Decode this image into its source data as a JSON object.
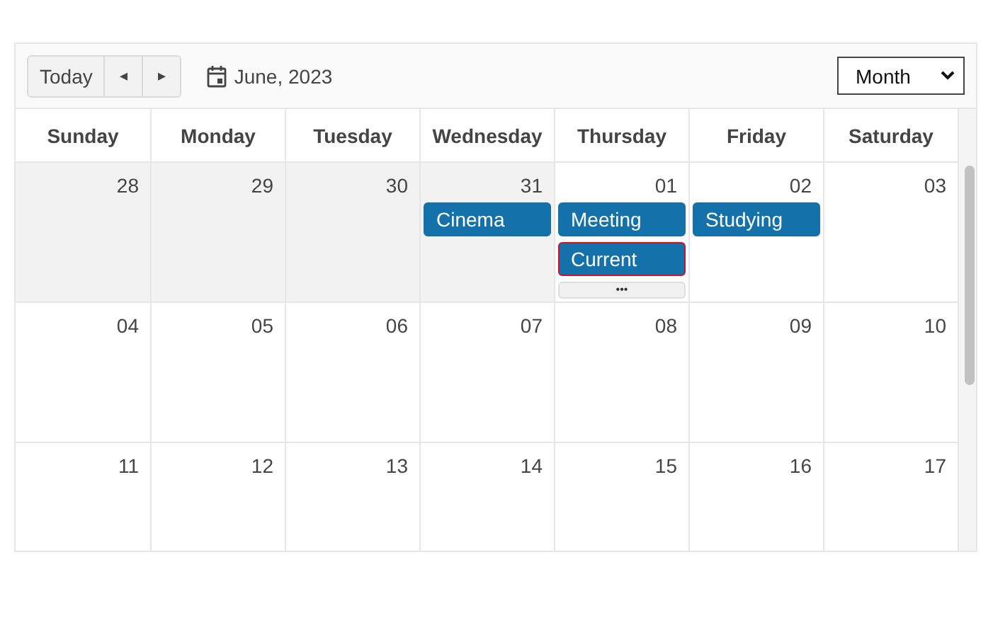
{
  "toolbar": {
    "today": "Today",
    "prev": "◂",
    "next": "▸",
    "date": "June, 2023",
    "view": "Month"
  },
  "weekdays": [
    "Sunday",
    "Monday",
    "Tuesday",
    "Wednesday",
    "Thursday",
    "Friday",
    "Saturday"
  ],
  "weeks": [
    {
      "days": [
        {
          "date": "28",
          "other_month": true
        },
        {
          "date": "29",
          "other_month": true
        },
        {
          "date": "30",
          "other_month": true
        },
        {
          "date": "31",
          "other_month": true,
          "events": [
            {
              "title": "Cinema",
              "current": false
            }
          ]
        },
        {
          "date": "01",
          "other_month": false,
          "events": [
            {
              "title": "Meeting",
              "current": false
            },
            {
              "title": "Current",
              "current": true
            }
          ],
          "more": "•••"
        },
        {
          "date": "02",
          "other_month": false,
          "events": [
            {
              "title": "Studying",
              "current": false
            }
          ]
        },
        {
          "date": "03",
          "other_month": false
        }
      ]
    },
    {
      "days": [
        {
          "date": "04",
          "other_month": false
        },
        {
          "date": "05",
          "other_month": false
        },
        {
          "date": "06",
          "other_month": false
        },
        {
          "date": "07",
          "other_month": false
        },
        {
          "date": "08",
          "other_month": false
        },
        {
          "date": "09",
          "other_month": false
        },
        {
          "date": "10",
          "other_month": false
        }
      ]
    },
    {
      "days": [
        {
          "date": "11",
          "other_month": false
        },
        {
          "date": "12",
          "other_month": false
        },
        {
          "date": "13",
          "other_month": false
        },
        {
          "date": "14",
          "other_month": false
        },
        {
          "date": "15",
          "other_month": false
        },
        {
          "date": "16",
          "other_month": false
        },
        {
          "date": "17",
          "other_month": false
        }
      ]
    }
  ]
}
